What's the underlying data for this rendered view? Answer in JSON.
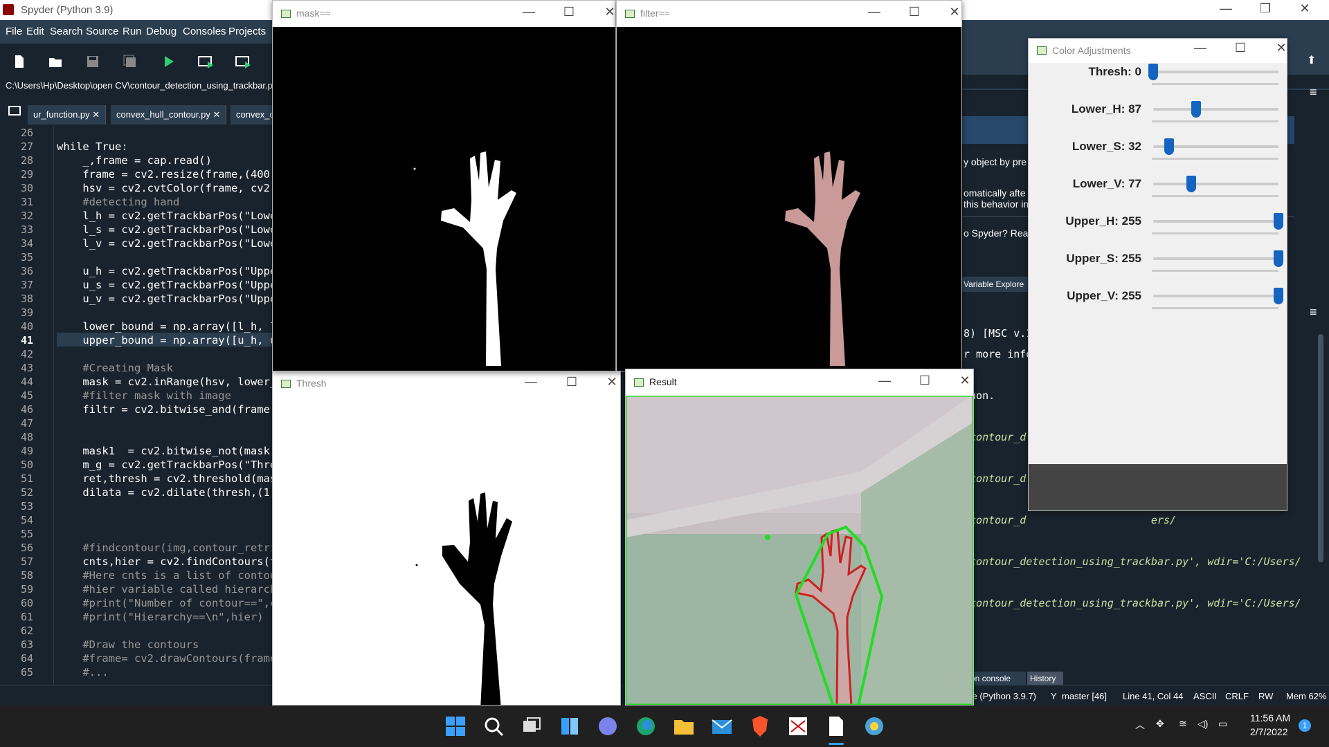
{
  "spyder": {
    "title": "Spyder (Python 3.9)",
    "menu": [
      "File",
      "Edit",
      "Search",
      "Source",
      "Run",
      "Debug",
      "Consoles",
      "Projects"
    ],
    "path": "C:\\Users\\Hp\\Desktop\\open CV\\contour_detection_using_trackbar.py",
    "tabs": [
      "ur_function.py",
      "convex_hull_contour.py",
      "convex_c"
    ],
    "line_numbers": [
      "26",
      "27",
      "28",
      "29",
      "30",
      "31",
      "32",
      "33",
      "34",
      "35",
      "36",
      "37",
      "38",
      "39",
      "40",
      "41",
      "42",
      "43",
      "44",
      "45",
      "46",
      "47",
      "48",
      "49",
      "50",
      "51",
      "52",
      "53",
      "54",
      "55",
      "56",
      "57",
      "58",
      "59",
      "60",
      "61",
      "62",
      "63",
      "64",
      "65"
    ],
    "code_lines": [
      "",
      "while True:",
      "    _,frame = cap.read()",
      "    frame = cv2.resize(frame,(400,4",
      "    hsv = cv2.cvtColor(frame, cv2.C",
      "    #detecting hand",
      "    l_h = cv2.getTrackbarPos(\"Lowe",
      "    l_s = cv2.getTrackbarPos(\"Lowe",
      "    l_v = cv2.getTrackbarPos(\"Lowe",
      "",
      "    u_h = cv2.getTrackbarPos(\"Uppe",
      "    u_s = cv2.getTrackbarPos(\"Uppe",
      "    u_v = cv2.getTrackbarPos(\"Uppe",
      "",
      "    lower_bound = np.array([l_h, l",
      "    upper_bound = np.array([u_h, u",
      "",
      "    #Creating Mask",
      "    mask = cv2.inRange(hsv, lower_b",
      "    #filter mask with image",
      "    filtr = cv2.bitwise_and(frame,",
      "",
      "",
      "    mask1  = cv2.bitwise_not(mask)",
      "    m_g = cv2.getTrackbarPos(\"Thres",
      "    ret,thresh = cv2.threshold(mask",
      "    dilata = cv2.dilate(thresh,(1,1",
      "",
      "",
      "",
      "    #findcontour(img,contour_retri",
      "    cnts,hier = cv2.findContours(th",
      "    #Here cnts is a list of contour",
      "    #hier variable called hierarchy",
      "    #print(\"Number of contour==\",cn",
      "    #print(\"Hierarchy==\\n\",hier)",
      "",
      "    #Draw the contours",
      "    #frame= cv2.drawContours(frame,",
      "    #..."
    ],
    "right_pane": {
      "help_text_1": "y object by pre",
      "help_text_2": "omatically afte",
      "help_text_3": "this behavior in",
      "help_text_4": "o Spyder? Rea",
      "variable_explorer_tab": "Variable Explore",
      "console_lines": [
        "8) [MSC v.1",
        "r more info",
        "",
        "thon.",
        "",
        "/contour_d                    ers/",
        "",
        "/contour_d                    ers/",
        "",
        "/contour_d                    ers/",
        "",
        "/contour_detection_using_trackbar.py', wdir='C:/Users/",
        "",
        "/contour_detection_using_trackbar.py', wdir='C:/Users/"
      ],
      "console_tabs": [
        "thon console",
        "History"
      ]
    },
    "status": {
      "interpreter": "se (Python 3.9.7)",
      "git": "master [46]",
      "position": "Line 41, Col 44",
      "encoding": "ASCII",
      "eol": "CRLF",
      "rw": "RW",
      "mem": "Mem 62%"
    }
  },
  "windows": {
    "mask": {
      "title": "mask=="
    },
    "filter": {
      "title": "filter=="
    },
    "thresh": {
      "title": "Thresh"
    },
    "result": {
      "title": "Result"
    },
    "color_adjust": {
      "title": "Color Adjustments",
      "sliders": [
        {
          "label": "Thresh: 0",
          "value": 0,
          "max": 255
        },
        {
          "label": "Lower_H: 87",
          "value": 87,
          "max": 255
        },
        {
          "label": "Lower_S: 32",
          "value": 32,
          "max": 255
        },
        {
          "label": "Lower_V: 77",
          "value": 77,
          "max": 255
        },
        {
          "label": "Upper_H: 255",
          "value": 255,
          "max": 255
        },
        {
          "label": "Upper_S: 255",
          "value": 255,
          "max": 255
        },
        {
          "label": "Upper_V: 255",
          "value": 255,
          "max": 255
        }
      ]
    }
  },
  "taskbar": {
    "time": "11:56 AM",
    "date": "2/7/2022",
    "notification_count": "1",
    "icons": [
      "windows-start-icon",
      "search-icon",
      "task-view-icon",
      "widgets-icon",
      "teams-chat-icon",
      "edge-icon",
      "file-explorer-icon",
      "mail-icon",
      "brave-icon",
      "spyder-icon",
      "notepad-icon",
      "python-icon"
    ]
  },
  "colors": {
    "spyder_bg": "#19232d",
    "spyder_panel": "#2b3e50",
    "slider_accent": "#1565c0",
    "contour_green": "#22dd22",
    "contour_red": "#cc2222"
  }
}
